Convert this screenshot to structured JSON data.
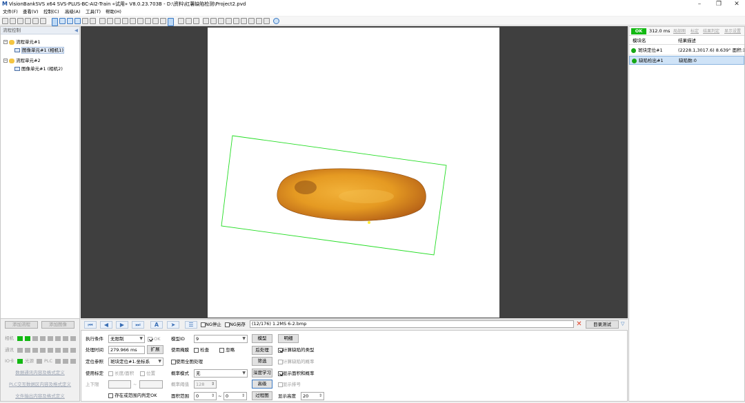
{
  "titlebar": {
    "title": "VisionBankSVS x64 SVS-PLUS-BC-AI2-Train «试用» V8.0.23.703B - D:\\资料\\红薯缺陷检测\\Project2.pvd",
    "minimize": "–",
    "maximize": "❐",
    "close": "✕"
  },
  "menu": [
    "文件(F)",
    "查看(V)",
    "控制(C)",
    "高级(A)",
    "工具(T)",
    "帮助(H)"
  ],
  "left": {
    "header": "流程控制",
    "tree": [
      {
        "label": "流程单元#1",
        "child": "图像单元#1 (相机1)"
      },
      {
        "label": "流程单元#2",
        "child": "图像单元#1 (相机2)"
      }
    ],
    "add_flow": "添加流程",
    "add_image": "添加图像",
    "status": {
      "camera": "相机",
      "comm": "通讯",
      "io": "IO卡",
      "light": "光源",
      "plc": "PLC"
    },
    "links": [
      "数据通讯内容及格式定义",
      "PLC交互数据区内容及格式定义",
      "文件输出内容及格式定义"
    ]
  },
  "navbar": {
    "ng_stop": "NG停止",
    "ng_save": "NG另存",
    "path": "(12/176) 1.2MS 6-2.bmp",
    "dir_test": "目录测试"
  },
  "bottom": {
    "exec_cond_label": "执行条件",
    "exec_cond_value": "无限制",
    "ok_label": "OK",
    "proc_time_label": "处理时间",
    "proc_time_value": "279.966 ms",
    "expand_btn": "扩展",
    "pos_ref_label": "定位参照",
    "pos_ref_value": "斑块定位#1.坐标系",
    "use_calib_label": "使用标定",
    "len_area_label": "长度/面积",
    "position_label": "位置",
    "upper_lower_label": "上下限",
    "range_sep": "~",
    "in_range_ok": "存在或范围内判定OK",
    "model_id_label": "模型ID",
    "model_id_value": "9",
    "model_btn": "模型",
    "detail_btn": "明细",
    "use_mask_label": "使用掩膜",
    "check_label": "检查",
    "ignore_label": "忽略",
    "postproc_btn": "后处理",
    "calc_defect_type": "计算缺陷的类型",
    "use_full_img": "使用全图处理",
    "filter_btn": "筛选",
    "calc_defect_prob": "计算缺陷的概率",
    "prob_mode_label": "概率模式",
    "prob_mode_value": "无",
    "deep_learn_btn": "深度学习",
    "show_area_prob": "显示面积和概率",
    "prob_thresh_label": "概率阈值",
    "prob_thresh_value": "128",
    "advanced_btn": "高级",
    "show_sort": "显示排号",
    "area_range_label": "面积范围",
    "area_min": "0",
    "area_max": "0",
    "process_img_btn": "过程图",
    "display_height_label": "显示高度",
    "display_height_value": "20"
  },
  "right": {
    "ok_badge": "OK",
    "time": "312.0 ms",
    "links": [
      "局部图",
      "标定",
      "结果判定",
      "显示设置"
    ],
    "col_module": "模块名",
    "col_desc": "结果描述",
    "rows": [
      {
        "name": "斑块定位#1",
        "desc": "(2228.1,3017.6) 8.639° 面积:10:"
      },
      {
        "name": "缺陷检出#1",
        "desc": "缺陷数:0"
      }
    ]
  },
  "colors": {
    "ok_green": "#13b913",
    "roi_green": "#22dd22",
    "selection_blue": "#cfe3f7"
  }
}
